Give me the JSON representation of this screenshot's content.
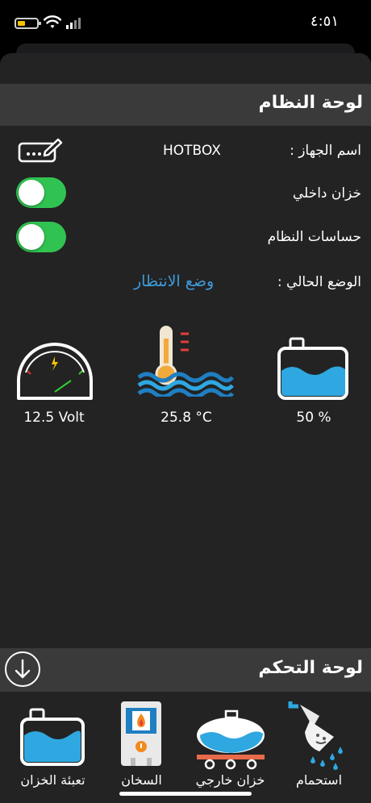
{
  "status_bar": {
    "time": "٤:٥١"
  },
  "system_panel": {
    "title": "لوحة النظام",
    "device_name_label": "اسم الجهاز :",
    "device_name_value": "HOTBOX",
    "internal_tank_label": "خزان داخلي",
    "internal_tank_on": true,
    "system_sensors_label": "حساسات النظام",
    "system_sensors_on": true,
    "current_mode_label": "الوضع الحالي :",
    "current_mode_value": "وضع الانتظار"
  },
  "gauges": {
    "voltage": {
      "value": "12.5 Volt"
    },
    "temperature": {
      "value": "25.8 °C"
    },
    "tank_level": {
      "value": "50 %"
    }
  },
  "control_panel": {
    "title": "لوحة التحكم"
  },
  "tabs": [
    {
      "label": "تعبئة الخزان"
    },
    {
      "label": "السخان"
    },
    {
      "label": "خزان خارجي"
    },
    {
      "label": "استحمام"
    }
  ],
  "colors": {
    "accent_blue": "#3d9bdc",
    "toggle_green": "#31c352",
    "header_gray": "#3a3a3a"
  }
}
